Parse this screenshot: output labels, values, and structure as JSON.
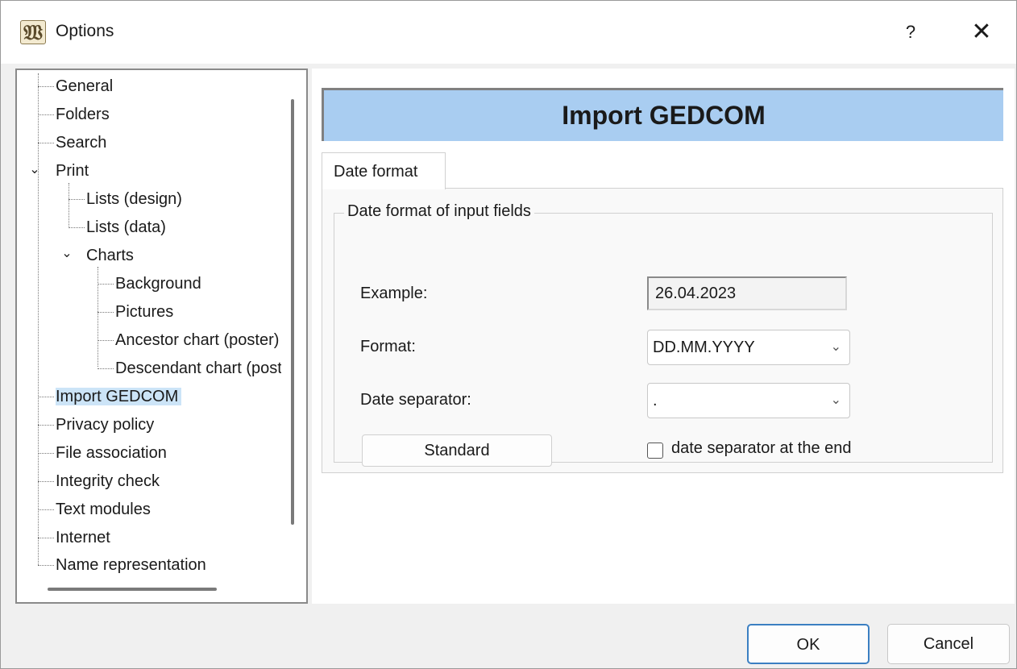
{
  "window": {
    "title": "Options",
    "app_icon_glyph": "𝔚",
    "help_label": "?",
    "close_glyph": "✕"
  },
  "tree": {
    "items": [
      {
        "label": "General"
      },
      {
        "label": "Folders"
      },
      {
        "label": "Search"
      },
      {
        "label": "Print",
        "expanded": true
      },
      {
        "label": "Lists (design)"
      },
      {
        "label": "Lists (data)"
      },
      {
        "label": "Charts",
        "expanded": true
      },
      {
        "label": "Background"
      },
      {
        "label": "Pictures"
      },
      {
        "label": "Ancestor chart (poster)"
      },
      {
        "label": "Descendant chart (poster)"
      },
      {
        "label": "Import GEDCOM",
        "selected": true
      },
      {
        "label": "Privacy policy"
      },
      {
        "label": "File association"
      },
      {
        "label": "Integrity check"
      },
      {
        "label": "Text modules"
      },
      {
        "label": "Internet"
      },
      {
        "label": "Name representation"
      }
    ]
  },
  "panel": {
    "header": "Import GEDCOM",
    "tab_label": "Date format",
    "group_title": "Date format of input fields",
    "example_label": "Example:",
    "example_value": "26.04.2023",
    "format_label": "Format:",
    "format_value": "DD.MM.YYYY",
    "separator_label": "Date separator:",
    "separator_value": ".",
    "standard_button": "Standard",
    "checkbox_label": "date separator at the end",
    "checkbox_checked": false
  },
  "footer": {
    "ok_label": "OK",
    "cancel_label": "Cancel"
  },
  "colors": {
    "header_bg": "#a9cdf1",
    "selection_bg": "#cce4f7",
    "ok_border": "#3b7fc2"
  }
}
